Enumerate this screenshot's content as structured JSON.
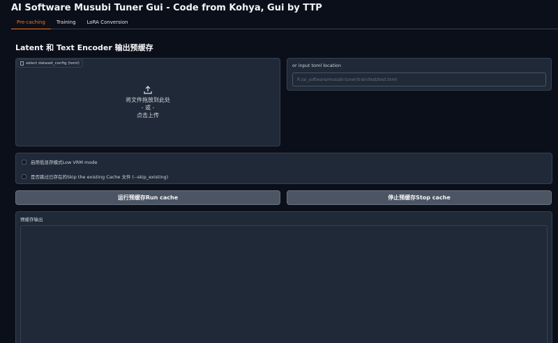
{
  "app": {
    "title": "AI Software Musubi Tuner Gui - Code from Kohya, Gui by TTP"
  },
  "tabs": [
    {
      "label": "Pre-caching",
      "active": true
    },
    {
      "label": "Training",
      "active": false
    },
    {
      "label": "LoRA Conversion",
      "active": false
    }
  ],
  "section": {
    "title": "Latent 和 Text Encoder 输出预缓存"
  },
  "upload": {
    "file_label": "select dataset_config (toml)",
    "drop_text": "将文件拖放到此处",
    "or_text": "- 或 -",
    "click_text": "点击上传",
    "icon": "upload-icon"
  },
  "toml": {
    "label": "or input toml location",
    "placeholder": "R:/ai_software/musubi-tuner/train/test/test.toml"
  },
  "options": {
    "low_vram": "启用低显存模式Low VRM mode",
    "skip_existing": "是否跳过已存在的Skip the existing Cache 文件 (--skip_existing)"
  },
  "buttons": {
    "run": "运行预缓存Run cache",
    "stop": "停止预缓存Stop cache"
  },
  "output": {
    "label": "预缓存输出",
    "value": ""
  },
  "colors": {
    "background": "#0b0f19",
    "panel": "#1f2937",
    "accent": "#f97316",
    "button": "#4b5563"
  }
}
